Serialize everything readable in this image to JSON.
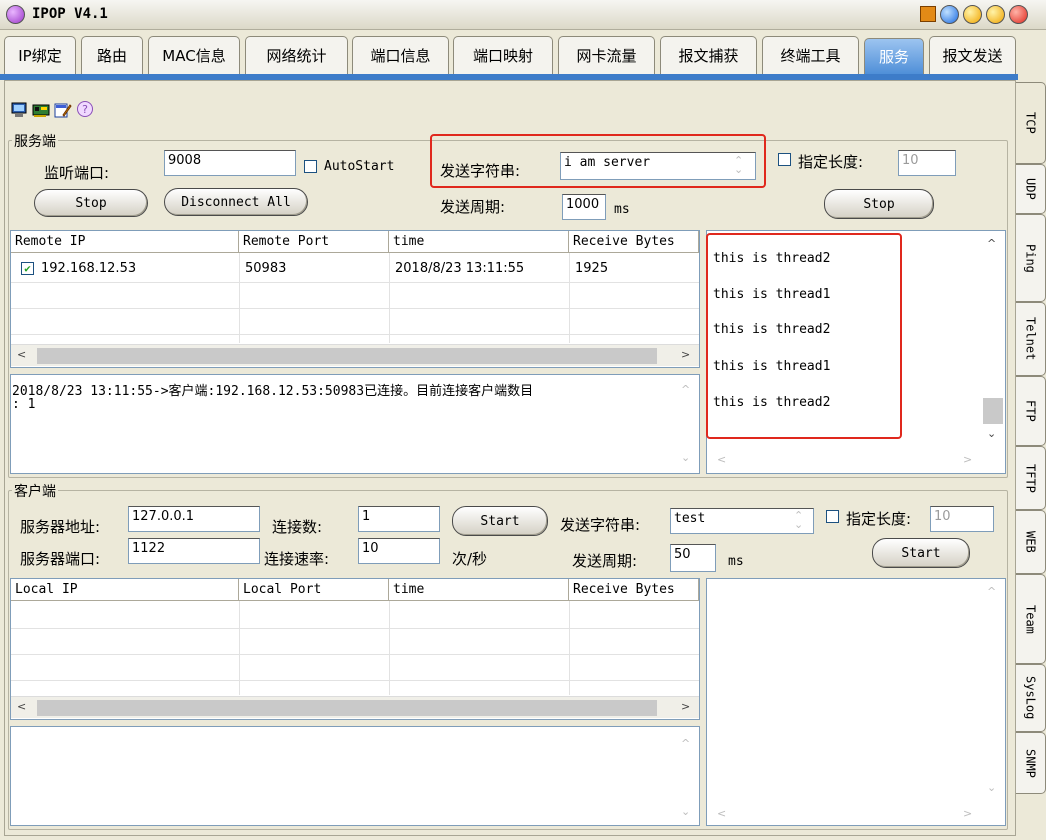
{
  "window": {
    "title": "IPOP V4.1"
  },
  "tabs": [
    {
      "label": "IP绑定"
    },
    {
      "label": "路由"
    },
    {
      "label": "MAC信息"
    },
    {
      "label": "网络统计"
    },
    {
      "label": "端口信息"
    },
    {
      "label": "端口映射"
    },
    {
      "label": "网卡流量"
    },
    {
      "label": "报文捕获"
    },
    {
      "label": "终端工具"
    },
    {
      "label": "服务",
      "active": true
    },
    {
      "label": "报文发送"
    }
  ],
  "side_tabs": [
    "TCP",
    "UDP",
    "Ping",
    "Telnet",
    "FTP",
    "TFTP",
    "WEB",
    "Team",
    "SysLog",
    "SNMP"
  ],
  "toolbar_icons": [
    "computer-icon",
    "network-card-icon",
    "edit-icon",
    "help-icon"
  ],
  "server": {
    "group_title": "服务端",
    "listen_port_label": "监听端口:",
    "listen_port_value": "9008",
    "autostart_label": "AutoStart",
    "send_string_label": "发送字符串:",
    "send_string_value": "i am server",
    "fixed_length_label": "指定长度:",
    "fixed_length_value": "10",
    "stop_label": "Stop",
    "disconnect_label": "Disconnect All",
    "send_period_label": "发送周期:",
    "send_period_value": "1000",
    "send_period_unit": "ms",
    "stop2_label": "Stop",
    "table": {
      "headers": [
        "Remote IP",
        "Remote Port",
        "time",
        "Receive Bytes"
      ],
      "rows": [
        {
          "checked": true,
          "ip": "192.168.12.53",
          "port": "50983",
          "time": "2018/8/23 13:11:55",
          "bytes": "1925"
        }
      ]
    },
    "log": [
      "2018/8/23 13:11:55->客户端:192.168.12.53:50983已连接。目前连接客户端数目",
      ": 1"
    ],
    "received": [
      "this is thread2",
      "this is thread1",
      "this is thread2",
      "this is thread1",
      "this is thread2"
    ]
  },
  "client": {
    "group_title": "客户端",
    "server_addr_label": "服务器地址:",
    "server_addr_value": "127.0.0.1",
    "conn_count_label": "连接数:",
    "conn_count_value": "1",
    "start_label": "Start",
    "send_string_label": "发送字符串:",
    "send_string_value": "test",
    "fixed_length_label": "指定长度:",
    "fixed_length_value": "10",
    "server_port_label": "服务器端口:",
    "server_port_value": "1122",
    "conn_rate_label": "连接速率:",
    "conn_rate_value": "10",
    "conn_rate_unit": "次/秒",
    "send_period_label": "发送周期:",
    "send_period_value": "50",
    "send_period_unit": "ms",
    "start2_label": "Start",
    "table": {
      "headers": [
        "Local IP",
        "Local Port",
        "time",
        "Receive Bytes"
      ]
    }
  }
}
